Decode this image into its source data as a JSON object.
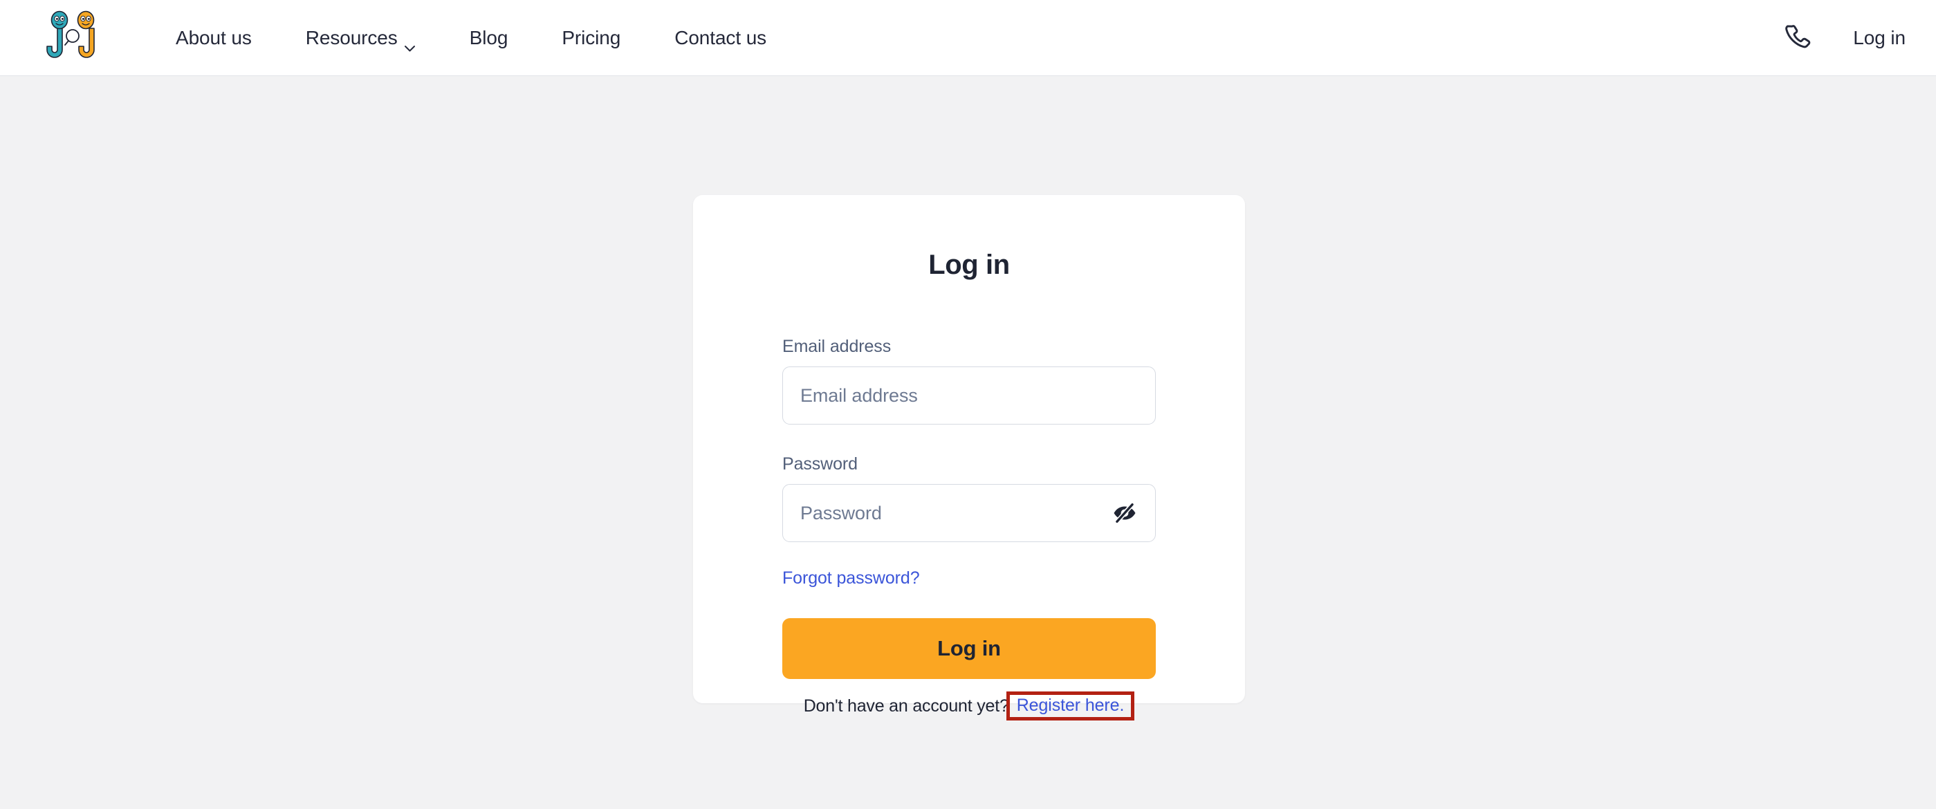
{
  "header": {
    "logo_alt": "jobjagger-logo",
    "logo_colors": {
      "left_j": "#2FA8B8",
      "right_j": "#F5A623",
      "outline": "#1f2433"
    },
    "nav": [
      {
        "label": "About us",
        "has_dropdown": false
      },
      {
        "label": "Resources",
        "has_dropdown": true
      },
      {
        "label": "Blog",
        "has_dropdown": false
      },
      {
        "label": "Pricing",
        "has_dropdown": false
      },
      {
        "label": "Contact us",
        "has_dropdown": false
      }
    ],
    "phone_icon": "phone-icon",
    "login_link": "Log in"
  },
  "login_card": {
    "title": "Log in",
    "email": {
      "label": "Email address",
      "placeholder": "Email address",
      "value": ""
    },
    "password": {
      "label": "Password",
      "placeholder": "Password",
      "value": "",
      "toggle_icon": "eye-off-icon"
    },
    "forgot_password": "Forgot password?",
    "submit_label": "Log in",
    "register_prompt": "Don't have an account yet?",
    "register_link": "Register here."
  },
  "colors": {
    "page_background": "#f2f2f3",
    "card_background": "#ffffff",
    "accent_orange": "#fba622",
    "link_blue": "#3b55d9",
    "text_dark": "#1f2433",
    "label_grey": "#525f79",
    "input_border": "#d6dae2",
    "highlight_red": "#b32113"
  }
}
